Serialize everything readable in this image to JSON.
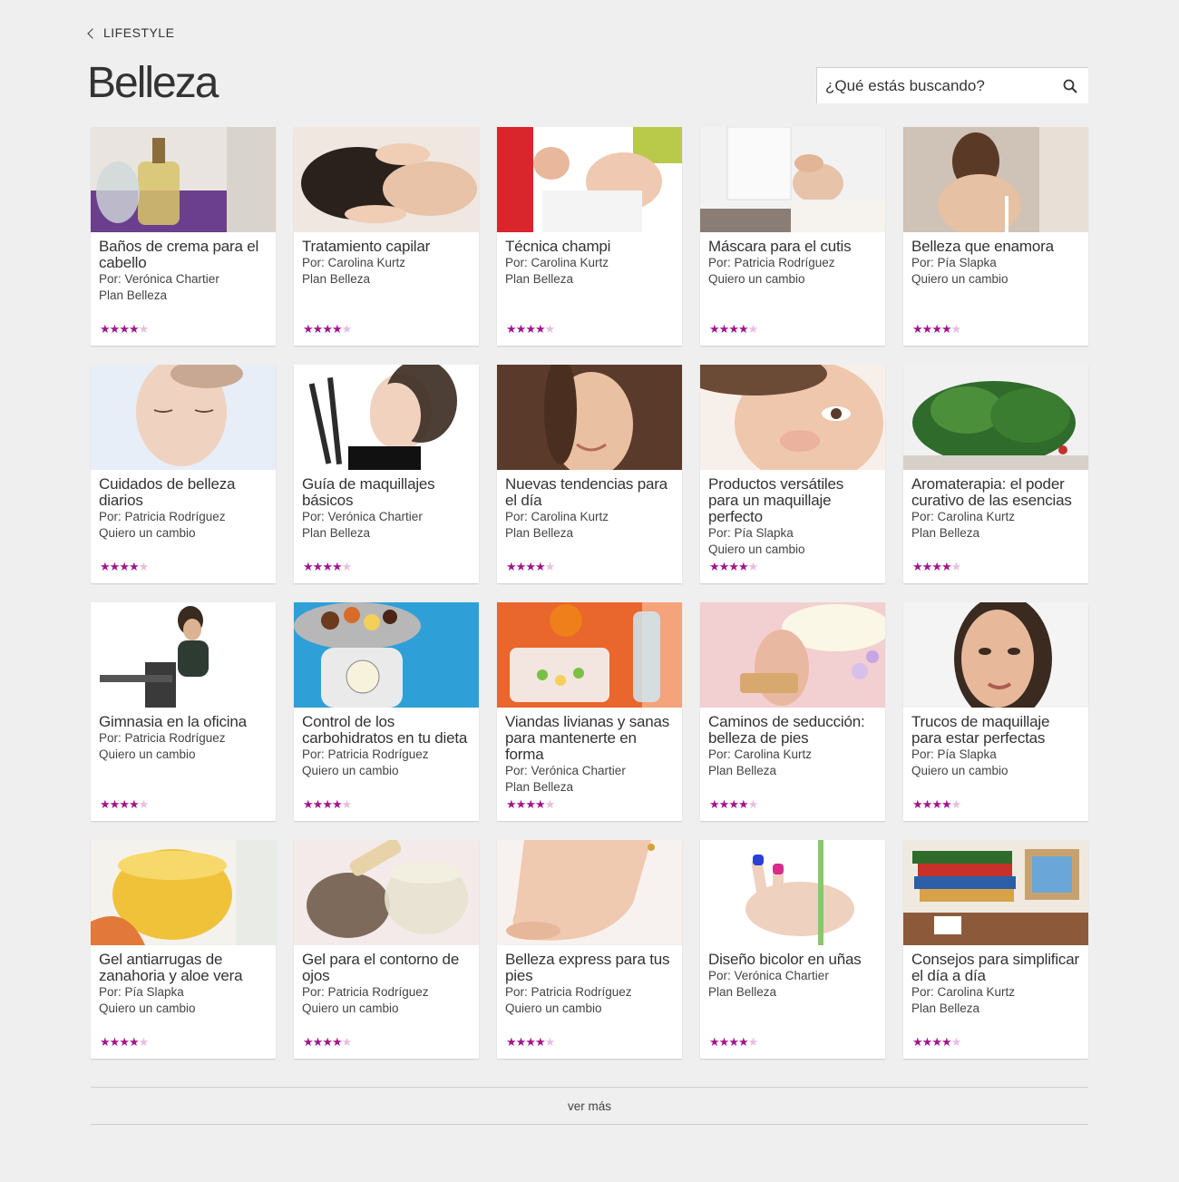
{
  "nav": {
    "back_label": "LIFESTYLE"
  },
  "page": {
    "title": "Belleza"
  },
  "search": {
    "placeholder": "¿Qué estás buscando?",
    "icon": "search-icon"
  },
  "accent_color": "#a2148c",
  "cards": [
    {
      "title": "Baños de crema para el cabello",
      "author": "Por: Verónica Chartier",
      "plan": "Plan Belleza",
      "rating": 4,
      "max_rating": 5,
      "image": "oil-bottles"
    },
    {
      "title": "Tratamiento capilar",
      "author": "Por: Carolina Kurtz",
      "plan": "Plan Belleza",
      "rating": 4,
      "max_rating": 5,
      "image": "scalp-massage"
    },
    {
      "title": "Técnica champi",
      "author": "Por: Carolina Kurtz",
      "plan": "Plan Belleza",
      "rating": 4,
      "max_rating": 5,
      "image": "head-massage"
    },
    {
      "title": "Máscara para el cutis",
      "author": "Por: Patricia Rodríguez",
      "plan": "Quiero un cambio",
      "rating": 4,
      "max_rating": 5,
      "image": "facial-treatment"
    },
    {
      "title": "Belleza que enamora",
      "author": "Por: Pía Slapka",
      "plan": "Quiero un cambio",
      "rating": 4,
      "max_rating": 5,
      "image": "woman-back"
    },
    {
      "title": "Cuidados de belleza diarios",
      "author": "Por: Patricia Rodríguez",
      "plan": "Quiero un cambio",
      "rating": 4,
      "max_rating": 5,
      "image": "woman-face"
    },
    {
      "title": "Guía de maquillajes básicos",
      "author": "Por: Verónica Chartier",
      "plan": "Plan Belleza",
      "rating": 4,
      "max_rating": 5,
      "image": "makeup-brushes"
    },
    {
      "title": "Nuevas tendencias para el día",
      "author": "Por: Carolina Kurtz",
      "plan": "Plan Belleza",
      "rating": 4,
      "max_rating": 5,
      "image": "woman-smile"
    },
    {
      "title": "Productos versátiles para un maquillaje perfecto",
      "author": "Por: Pía Slapka",
      "plan": "Quiero un cambio",
      "rating": 4,
      "max_rating": 5,
      "image": "woman-closeup"
    },
    {
      "title": "Aromaterapia: el poder curativo de las esencias",
      "author": "Por: Carolina Kurtz",
      "plan": "Plan Belleza",
      "rating": 4,
      "max_rating": 5,
      "image": "herbs"
    },
    {
      "title": "Gimnasia en la oficina",
      "author": "Por: Patricia Rodríguez",
      "plan": "Quiero un cambio",
      "rating": 4,
      "max_rating": 5,
      "image": "woman-chair"
    },
    {
      "title": "Control de los carbohidratos en tu dieta",
      "author": "Por: Patricia Rodríguez",
      "plan": "Quiero un cambio",
      "rating": 4,
      "max_rating": 5,
      "image": "scale-sweets"
    },
    {
      "title": "Viandas livianas y sanas para mantenerte en forma",
      "author": "Por: Verónica Chartier",
      "plan": "Plan Belleza",
      "rating": 4,
      "max_rating": 5,
      "image": "food-containers"
    },
    {
      "title": "Caminos de seducción: belleza de pies",
      "author": "Por: Carolina Kurtz",
      "plan": "Plan Belleza",
      "rating": 4,
      "max_rating": 5,
      "image": "foot-massager"
    },
    {
      "title": "Trucos de maquillaje para estar perfectas",
      "author": "Por: Pía Slapka",
      "plan": "Quiero un cambio",
      "rating": 4,
      "max_rating": 5,
      "image": "woman-portrait"
    },
    {
      "title": "Gel antiarrugas de zanahoria y aloe vera",
      "author": "Por: Pía Slapka",
      "plan": "Quiero un cambio",
      "rating": 4,
      "max_rating": 5,
      "image": "gel-glass"
    },
    {
      "title": "Gel para el contorno de ojos",
      "author": "Por: Patricia Rodríguez",
      "plan": "Quiero un cambio",
      "rating": 4,
      "max_rating": 5,
      "image": "seeds-jar"
    },
    {
      "title": "Belleza express para tus pies",
      "author": "Por: Patricia Rodríguez",
      "plan": "Quiero un cambio",
      "rating": 4,
      "max_rating": 5,
      "image": "bare-foot"
    },
    {
      "title": "Diseño bicolor en uñas",
      "author": "Por: Verónica Chartier",
      "plan": "Plan Belleza",
      "rating": 4,
      "max_rating": 5,
      "image": "nail-art"
    },
    {
      "title": "Consejos para simplificar el día a día",
      "author": "Por: Carolina Kurtz",
      "plan": "Plan Belleza",
      "rating": 4,
      "max_rating": 5,
      "image": "books-desk"
    }
  ],
  "more": {
    "label": "ver más"
  }
}
